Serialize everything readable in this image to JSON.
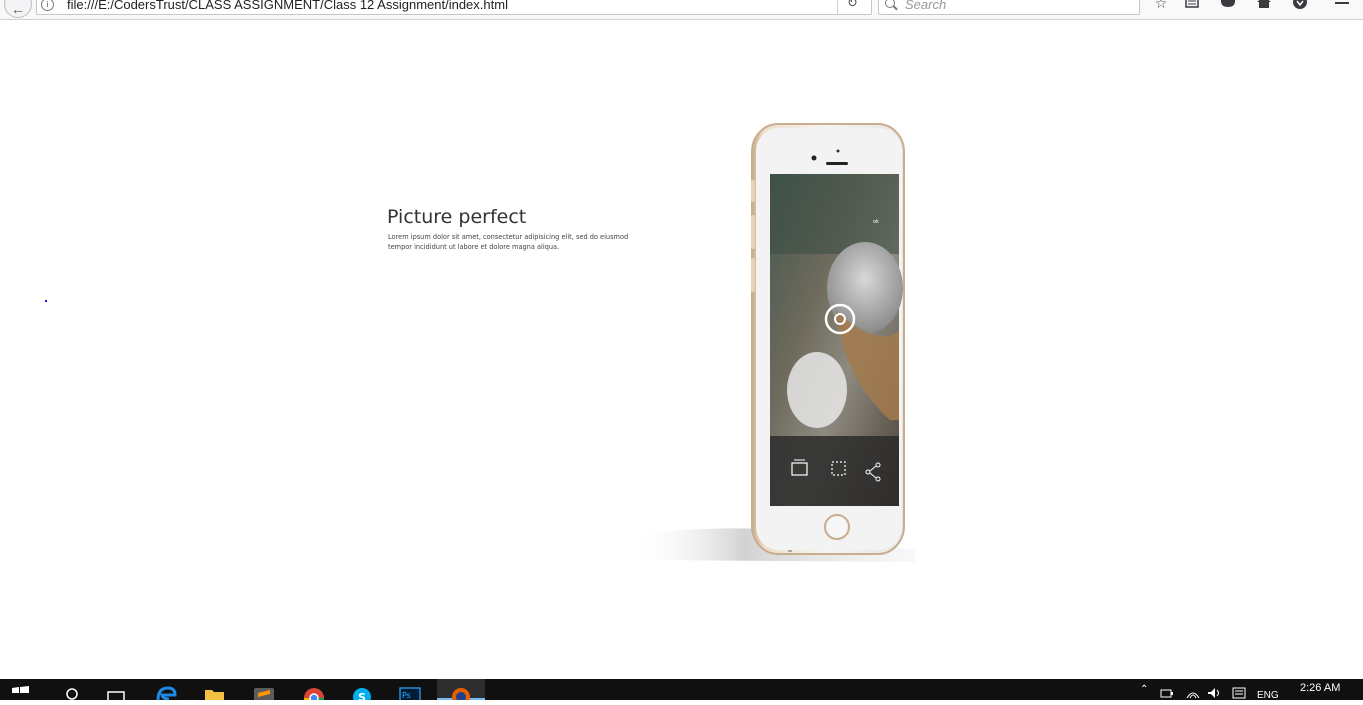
{
  "browser": {
    "url": "file:///E:/CodersTrust/CLASS ASSIGNMENT/Class 12 Assignment/index.html",
    "search_placeholder": "Search"
  },
  "page": {
    "title": "Picture perfect",
    "body": "Lorem ipsum dolor sit amet, consectetur adipisicing elit, sed do eiusmod tempor incididunt ut labore et dolore magna aliqua."
  },
  "phone": {
    "status_text": "ok"
  },
  "taskbar": {
    "language": "ENG",
    "time": "2:26 AM"
  },
  "icons": [
    "back-icon",
    "info-icon",
    "reload-icon",
    "search-icon",
    "bookmark-star-icon",
    "reading-list-icon",
    "pocket-icon",
    "home-icon",
    "downloads-icon",
    "menu-icon",
    "windows-start-icon",
    "cortana-search-icon",
    "task-view-icon",
    "edge-icon",
    "file-explorer-icon",
    "sublime-text-icon",
    "chrome-icon",
    "skype-icon",
    "photoshop-icon",
    "firefox-icon"
  ],
  "colors": {
    "taskbar": "#101010",
    "active_indicator": "#76b9ed",
    "phone_body": "#e6d3bd"
  }
}
